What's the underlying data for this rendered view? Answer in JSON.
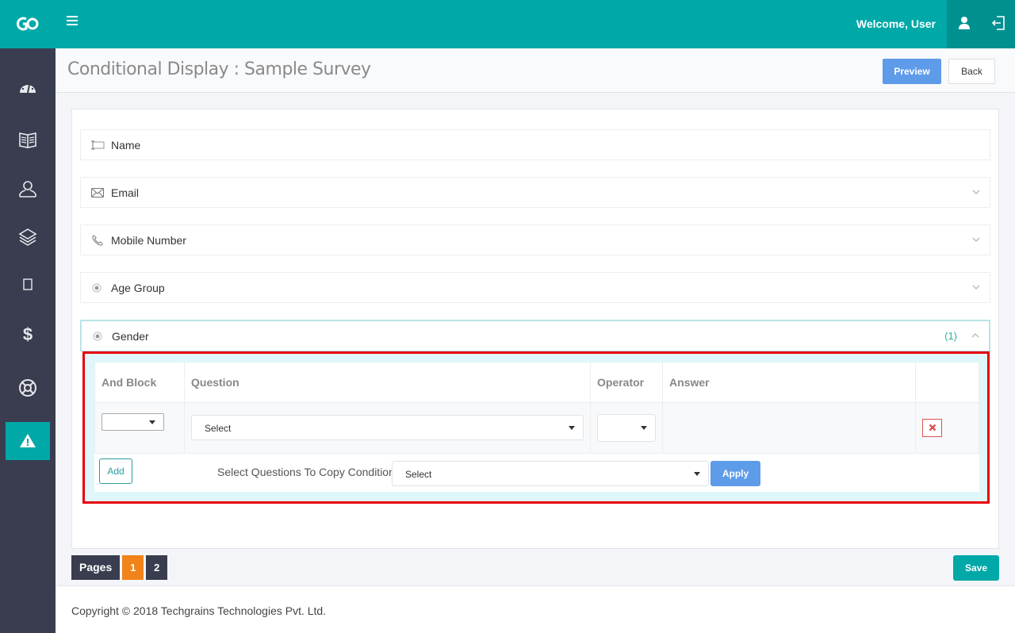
{
  "topbar": {
    "logo": "logo-icon",
    "menu_icon": "hamburger-icon",
    "welcome": "Welcome, User",
    "user_icon": "user-icon",
    "logout_icon": "logout-icon",
    "color": "#00a8a8"
  },
  "sidebar": {
    "items": [
      {
        "icon": "dashboard-icon",
        "active": false
      },
      {
        "icon": "book-icon",
        "active": false
      },
      {
        "icon": "user-icon",
        "active": false
      },
      {
        "icon": "layers-icon",
        "active": false
      },
      {
        "icon": "square-icon",
        "active": false
      },
      {
        "icon": "dollar-icon",
        "active": false
      },
      {
        "icon": "lifebuoy-icon",
        "active": false
      },
      {
        "icon": "warning-icon",
        "active": true
      }
    ]
  },
  "header": {
    "title": "Conditional Display : Sample Survey",
    "preview_label": "Preview",
    "back_label": "Back"
  },
  "questions": [
    {
      "label": "Name",
      "icon": "text-field-icon",
      "chevron": false
    },
    {
      "label": "Email",
      "icon": "envelope-icon",
      "chevron": true
    },
    {
      "label": "Mobile Number",
      "icon": "phone-icon",
      "chevron": true
    },
    {
      "label": "Age Group",
      "icon": "radio-icon",
      "chevron": true
    },
    {
      "label": "Gender",
      "icon": "radio-icon",
      "chevron": true,
      "open": true,
      "count": "(1)"
    }
  ],
  "conditions": {
    "headers": [
      "And Block",
      "Question",
      "Operator",
      "Answer",
      ""
    ],
    "rows": [
      {
        "and_block": "",
        "question": "Select",
        "operator": "",
        "answer": ""
      }
    ],
    "add_label": "Add",
    "copy_label": "Select Questions To Copy Conditions:",
    "copy_select": "Select",
    "apply_label": "Apply"
  },
  "pagination": {
    "label": "Pages",
    "pages": [
      "1",
      "2"
    ],
    "current": "1"
  },
  "save_label": "Save",
  "footer": {
    "copyright": "Copyright © 2018 Techgrains Technologies Pvt. Ltd."
  }
}
